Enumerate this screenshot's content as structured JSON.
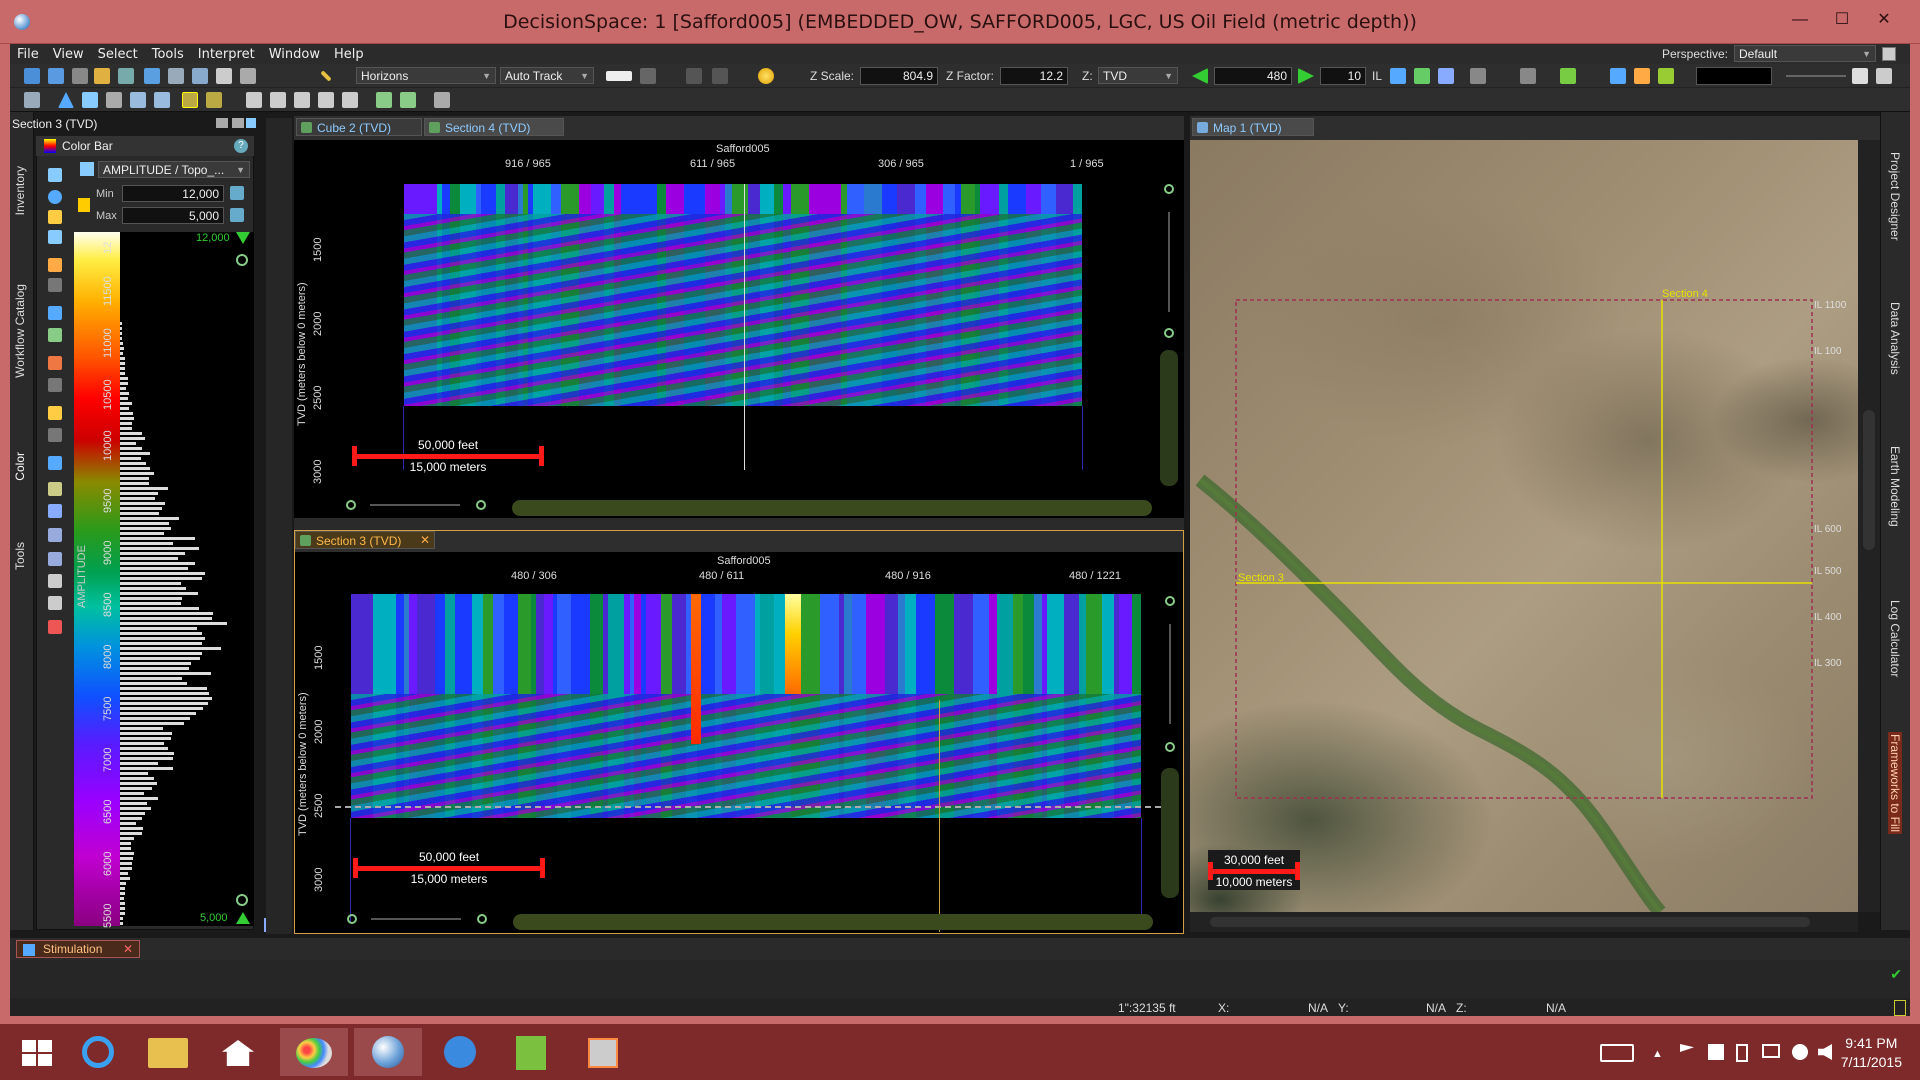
{
  "window": {
    "title": "DecisionSpace: 1 [Safford005] (EMBEDDED_OW, SAFFORD005, LGC, US Oil Field (metric depth))",
    "minimize_glyph": "—",
    "maximize_glyph": "☐",
    "close_glyph": "✕"
  },
  "menu": [
    "File",
    "View",
    "Select",
    "Tools",
    "Interpret",
    "Window",
    "Help"
  ],
  "perspective": {
    "label": "Perspective:",
    "value": "Default"
  },
  "toolbar": {
    "horizons_select": "Horizons",
    "autotrack_select": "Auto Track",
    "zscale_label": "Z Scale:",
    "zscale_value": "804.9",
    "zfactor_label": "Z Factor:",
    "zfactor_value": "12.2",
    "z_label": "Z:",
    "z_select": "TVD",
    "frame_value": "480",
    "step_value": "10",
    "il_label": "IL"
  },
  "left_panel": {
    "section_label": "Section 3 (TVD)",
    "vertical_tabs": [
      "Inventory",
      "Workflow Catalog",
      "Color",
      "Tools"
    ],
    "colorbar": {
      "title": "Color Bar",
      "attribute": "AMPLITUDE / Topo_...",
      "min_label": "Min",
      "min_value": "12,000",
      "max_label": "Max",
      "max_value": "5,000",
      "top_value": "12,000",
      "bottom_value": "5,000",
      "axis_label": "AMPLITUDE",
      "ticks": [
        "12",
        "11500",
        "11000",
        "10500",
        "10000",
        "9500",
        "9000",
        "8500",
        "8000",
        "7500",
        "7000",
        "6500",
        "6000",
        "5500"
      ]
    }
  },
  "section_top": {
    "tabs": [
      "Cube 2 (TVD)",
      "Section 4 (TVD)"
    ],
    "survey_name": "Safford005",
    "x_ticks": [
      "916 / 965",
      "611 / 965",
      "306 / 965",
      "1 / 965"
    ],
    "y_label": "TVD (meters below 0 meters)",
    "y_ticks": [
      "1500",
      "2000",
      "2500",
      "3000"
    ],
    "scale_feet": "50,000 feet",
    "scale_meters": "15,000 meters"
  },
  "section_bottom": {
    "tab": "Section 3 (TVD)",
    "survey_name": "Safford005",
    "x_ticks": [
      "480 / 306",
      "480 / 611",
      "480 / 916",
      "480 / 1221"
    ],
    "y_label": "TVD (meters below 0 meters)",
    "y_ticks": [
      "1500",
      "2000",
      "2500",
      "3000"
    ],
    "scale_feet": "50,000 feet",
    "scale_meters": "15,000 meters"
  },
  "map": {
    "tab": "Map 1 (TVD)",
    "section4_label": "Section 4",
    "section3_label": "Section 3",
    "il_labels": [
      "IL 1100",
      "IL 100",
      "IL 600",
      "IL 500",
      "IL 400",
      "IL 300"
    ],
    "scale_feet": "30,000 feet",
    "scale_meters": "10,000 meters"
  },
  "right_tabs": [
    "Project Designer",
    "Data Analysis",
    "Earth Modeling",
    "Log Calculator",
    "Frameworks to Fill"
  ],
  "bottom": {
    "tab": "Stimulation"
  },
  "status": {
    "scale": "1\":32135 ft",
    "x_label": "X:",
    "x_value": "N/A",
    "y_label": "Y:",
    "y_value": "N/A",
    "z_label": "Z:",
    "z_value": "N/A"
  },
  "taskbar": {
    "time": "9:41 PM",
    "date": "7/11/2015"
  },
  "colors": {
    "frame": "#c96a6a",
    "taskbar": "#7e2a2a",
    "tab_text": "#8ecbff",
    "scalebar": "#ff1a1a",
    "section_line": "#e8e000"
  }
}
